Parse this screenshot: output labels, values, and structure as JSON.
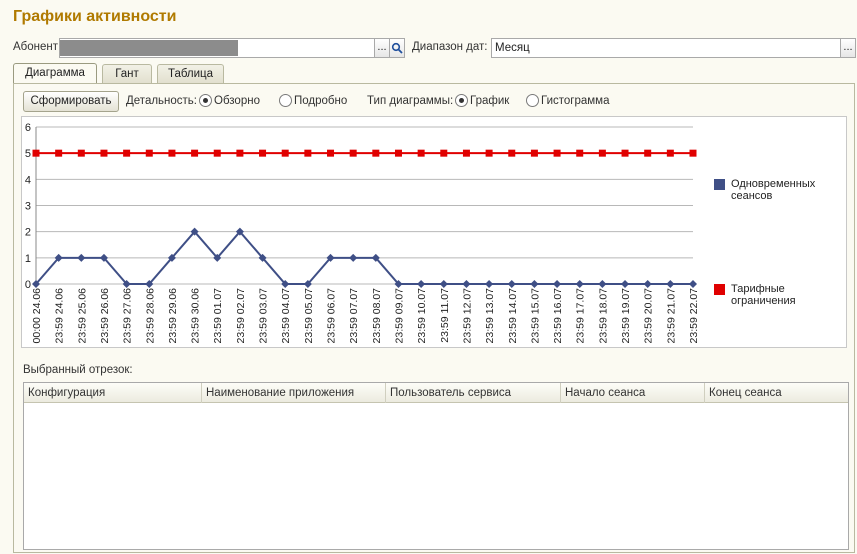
{
  "window": {
    "title": "Графики активности"
  },
  "filter": {
    "subscriber_label": "Абонент:",
    "subscriber_value": "",
    "date_range_label": "Диапазон дат:",
    "date_range_value": "Месяц",
    "select_btn": "...",
    "search_icon": "magnifier-icon"
  },
  "tabs": [
    {
      "label": "Диаграмма",
      "active": true
    },
    {
      "label": "Гант",
      "active": false
    },
    {
      "label": "Таблица",
      "active": false
    }
  ],
  "toolbar": {
    "form_button": "Сформировать",
    "detail_label": "Детальность:",
    "detail_options": [
      "Обзорно",
      "Подробно"
    ],
    "detail_selected": "Обзорно",
    "chart_type_label": "Тип диаграммы:",
    "chart_type_options": [
      "График",
      "Гистограмма"
    ],
    "chart_type_selected": "График"
  },
  "chart_data": {
    "type": "line",
    "ylim": [
      0,
      6
    ],
    "yticks": [
      "0",
      "1",
      "2",
      "3",
      "4",
      "5",
      "6"
    ],
    "grid": true,
    "legend_position": "right",
    "categories": [
      "00:00 24.06",
      "23:59 24.06",
      "23:59 25.06",
      "23:59 26.06",
      "23:59 27.06",
      "23:59 28.06",
      "23:59 29.06",
      "23:59 30.06",
      "23:59 01.07",
      "23:59 02.07",
      "23:59 03.07",
      "23:59 04.07",
      "23:59 05.07",
      "23:59 06.07",
      "23:59 07.07",
      "23:59 08.07",
      "23:59 09.07",
      "23:59 10.07",
      "23:59 11.07",
      "23:59 12.07",
      "23:59 13.07",
      "23:59 14.07",
      "23:59 15.07",
      "23:59 16.07",
      "23:59 17.07",
      "23:59 18.07",
      "23:59 19.07",
      "23:59 20.07",
      "23:59 21.07",
      "23:59 22.07"
    ],
    "series": [
      {
        "name": "Одновременных сеансов",
        "color": "#3f4f86",
        "marker": "diamond",
        "values": [
          0,
          1,
          1,
          1,
          0,
          0,
          1,
          2,
          1,
          2,
          1,
          0,
          0,
          1,
          1,
          1,
          0,
          0,
          0,
          0,
          0,
          0,
          0,
          0,
          0,
          0,
          0,
          0,
          0,
          0
        ]
      },
      {
        "name": "Тарифные ограничения",
        "color": "#e00000",
        "marker": "square",
        "values": [
          5,
          5,
          5,
          5,
          5,
          5,
          5,
          5,
          5,
          5,
          5,
          5,
          5,
          5,
          5,
          5,
          5,
          5,
          5,
          5,
          5,
          5,
          5,
          5,
          5,
          5,
          5,
          5,
          5,
          5
        ]
      }
    ]
  },
  "selection": {
    "label": "Выбранный отрезок:",
    "columns": [
      "Конфигурация",
      "Наименование приложения",
      "Пользователь сервиса",
      "Начало сеанса",
      "Конец сеанса"
    ],
    "rows": []
  }
}
